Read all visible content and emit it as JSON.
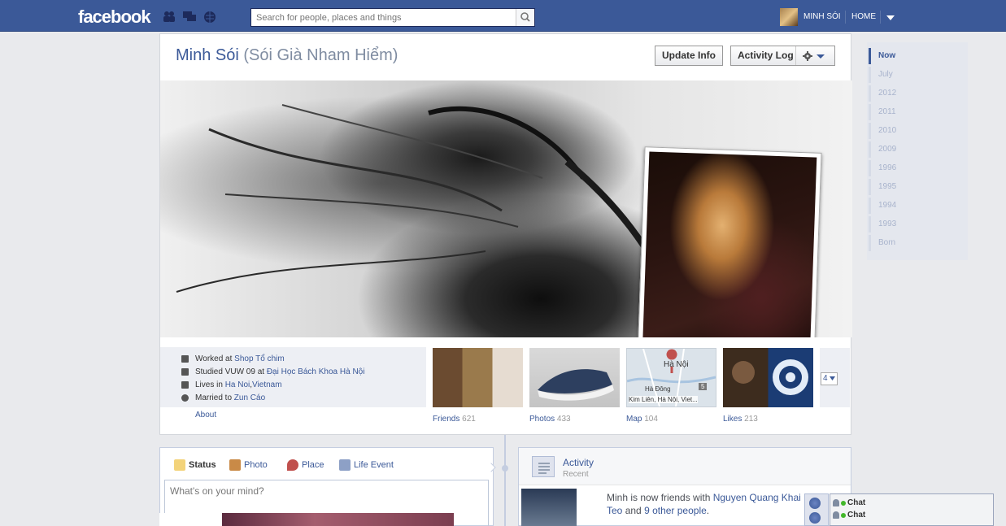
{
  "topbar": {
    "logo": "facebook",
    "search_placeholder": "Search for people, places and things",
    "user_name": "MINH SÓI",
    "home": "HOME"
  },
  "profile": {
    "name": "Minh Sói",
    "alt_name": "(Sói Già Nham Hiểm)",
    "update_info": "Update Info",
    "activity_log": "Activity Log"
  },
  "info": {
    "worked_prefix": "Worked at ",
    "worked_place": "Shop Tổ chim",
    "studied_prefix": "Studied VUW 09 at ",
    "studied_place": "Đại Học Bách Khoa Hà Nội",
    "lives_prefix": "Lives in ",
    "lives_city": "Ha Noi",
    "lives_sep": ", ",
    "lives_country": "Vietnam",
    "married_prefix": "Married to ",
    "married_person": "Zun Cáo",
    "about": "About"
  },
  "thumbs": {
    "friends": {
      "label": "Friends",
      "count": "621"
    },
    "photos": {
      "label": "Photos",
      "count": "433"
    },
    "map": {
      "label": "Map",
      "count": "104",
      "city": "Hà Nội",
      "district": "Hà Đông",
      "caption": "Kim Liên, Hà Nội, Viet...",
      "marker": "5"
    },
    "likes": {
      "label": "Likes",
      "count": "213"
    },
    "more": "4"
  },
  "composer": {
    "tab_status": "Status",
    "tab_photo": "Photo",
    "tab_place": "Place",
    "tab_life_event": "Life Event",
    "placeholder": "What's on your mind?"
  },
  "activity": {
    "title": "Activity",
    "subtitle": "Recent",
    "text_prefix": "Minh is now friends with ",
    "friend_name": "Nguyen Quang Khai",
    "text_mid_link": "Teo",
    "text_mid": " and ",
    "others": "9 other people",
    "text_end": "."
  },
  "scrubber": [
    "Now",
    "July",
    "2012",
    "2011",
    "2010",
    "2009",
    "1996",
    "1995",
    "1994",
    "1993",
    "Born"
  ],
  "chat": {
    "label1": "Chat",
    "label2": "Chat"
  },
  "colors": {
    "brand": "#3b5998",
    "background": "#e9eaed"
  }
}
